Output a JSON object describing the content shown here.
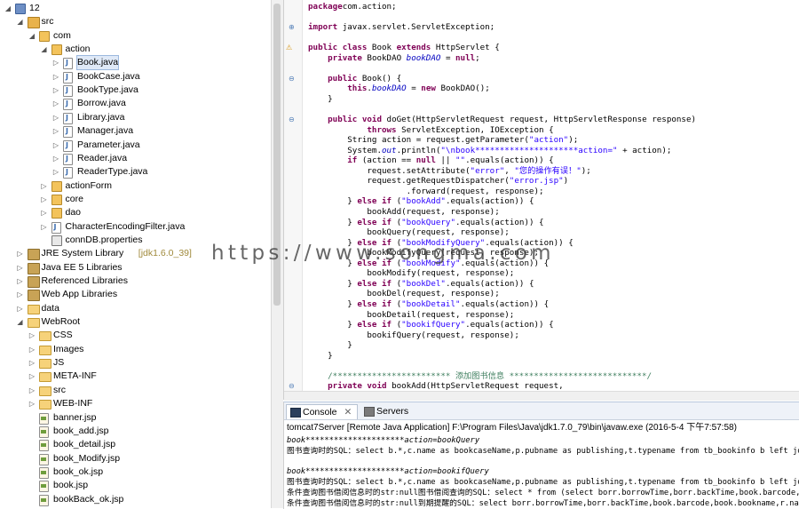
{
  "tree": [
    {
      "label": "12",
      "icon": "project-icon",
      "level": 0,
      "arrow": "down"
    },
    {
      "label": "src",
      "icon": "source-folder-icon",
      "level": 1,
      "arrow": "down"
    },
    {
      "label": "com",
      "icon": "package-icon",
      "level": 2,
      "arrow": "down"
    },
    {
      "label": "action",
      "icon": "package-icon",
      "level": 3,
      "arrow": "down"
    },
    {
      "label": "Book.java",
      "icon": "java-file-icon",
      "level": 4,
      "arrow": "right",
      "selected": true
    },
    {
      "label": "BookCase.java",
      "icon": "java-file-icon",
      "level": 4,
      "arrow": "right"
    },
    {
      "label": "BookType.java",
      "icon": "java-file-icon",
      "level": 4,
      "arrow": "right"
    },
    {
      "label": "Borrow.java",
      "icon": "java-file-icon",
      "level": 4,
      "arrow": "right"
    },
    {
      "label": "Library.java",
      "icon": "java-file-icon",
      "level": 4,
      "arrow": "right"
    },
    {
      "label": "Manager.java",
      "icon": "java-file-icon",
      "level": 4,
      "arrow": "right"
    },
    {
      "label": "Parameter.java",
      "icon": "java-file-icon",
      "level": 4,
      "arrow": "right"
    },
    {
      "label": "Reader.java",
      "icon": "java-file-icon",
      "level": 4,
      "arrow": "right"
    },
    {
      "label": "ReaderType.java",
      "icon": "java-file-icon",
      "level": 4,
      "arrow": "right"
    },
    {
      "label": "actionForm",
      "icon": "package-icon",
      "level": 3,
      "arrow": "right"
    },
    {
      "label": "core",
      "icon": "package-icon",
      "level": 3,
      "arrow": "right"
    },
    {
      "label": "dao",
      "icon": "package-icon",
      "level": 3,
      "arrow": "right"
    },
    {
      "label": "CharacterEncodingFilter.java",
      "icon": "java-file-icon",
      "level": 3,
      "arrow": "right"
    },
    {
      "label": "connDB.properties",
      "icon": "properties-file-icon",
      "level": 3,
      "arrow": ""
    },
    {
      "label": "JRE System Library",
      "deco": "[jdk1.6.0_39]",
      "icon": "library-icon",
      "level": 1,
      "arrow": "right"
    },
    {
      "label": "Java EE 5 Libraries",
      "icon": "library-icon",
      "level": 1,
      "arrow": "right"
    },
    {
      "label": "Referenced Libraries",
      "icon": "library-icon",
      "level": 1,
      "arrow": "right"
    },
    {
      "label": "Web App Libraries",
      "icon": "library-icon",
      "level": 1,
      "arrow": "right"
    },
    {
      "label": "data",
      "icon": "folder-icon",
      "level": 1,
      "arrow": "right"
    },
    {
      "label": "WebRoot",
      "icon": "folder-icon",
      "level": 1,
      "arrow": "down"
    },
    {
      "label": "CSS",
      "icon": "folder-icon",
      "level": 2,
      "arrow": "right"
    },
    {
      "label": "Images",
      "icon": "folder-icon",
      "level": 2,
      "arrow": "right"
    },
    {
      "label": "JS",
      "icon": "folder-icon",
      "level": 2,
      "arrow": "right"
    },
    {
      "label": "META-INF",
      "icon": "folder-icon",
      "level": 2,
      "arrow": "right"
    },
    {
      "label": "src",
      "icon": "folder-icon",
      "level": 2,
      "arrow": "right"
    },
    {
      "label": "WEB-INF",
      "icon": "folder-icon",
      "level": 2,
      "arrow": "right"
    },
    {
      "label": "banner.jsp",
      "icon": "jsp-file-icon",
      "level": 2,
      "arrow": ""
    },
    {
      "label": "book_add.jsp",
      "icon": "jsp-file-icon",
      "level": 2,
      "arrow": ""
    },
    {
      "label": "book_detail.jsp",
      "icon": "jsp-file-icon",
      "level": 2,
      "arrow": ""
    },
    {
      "label": "book_Modify.jsp",
      "icon": "jsp-file-icon",
      "level": 2,
      "arrow": ""
    },
    {
      "label": "book_ok.jsp",
      "icon": "jsp-file-icon",
      "level": 2,
      "arrow": ""
    },
    {
      "label": "book.jsp",
      "icon": "jsp-file-icon",
      "level": 2,
      "arrow": ""
    },
    {
      "label": "bookBack_ok.jsp",
      "icon": "jsp-file-icon",
      "level": 2,
      "arrow": ""
    }
  ],
  "code": [
    [
      [
        "kw",
        "package"
      ],
      [
        "",
        "com.action;"
      ]
    ],
    [],
    [
      [
        "kw",
        "import"
      ],
      [
        "",
        " javax.servlet.ServletException;"
      ]
    ],
    [],
    [
      [
        "kw",
        "public class"
      ],
      [
        "",
        " Book "
      ],
      [
        "kw",
        "extends"
      ],
      [
        "",
        " HttpServlet {"
      ]
    ],
    [
      [
        "",
        "    "
      ],
      [
        "kw",
        "private"
      ],
      [
        "",
        " BookDAO "
      ],
      [
        "fld",
        "bookDAO"
      ],
      [
        "",
        " = "
      ],
      [
        "kw",
        "null"
      ],
      [
        "",
        ";"
      ]
    ],
    [],
    [
      [
        "",
        "    "
      ],
      [
        "kw",
        "public"
      ],
      [
        "",
        " Book() {"
      ]
    ],
    [
      [
        "",
        "        "
      ],
      [
        "kw",
        "this"
      ],
      [
        "",
        "."
      ],
      [
        "fld",
        "bookDAO"
      ],
      [
        "",
        " = "
      ],
      [
        "kw",
        "new"
      ],
      [
        "",
        " BookDAO();"
      ]
    ],
    [
      [
        "",
        "    }"
      ]
    ],
    [],
    [
      [
        "",
        "    "
      ],
      [
        "kw",
        "public void"
      ],
      [
        "",
        " doGet(HttpServletRequest request, HttpServletResponse response)"
      ]
    ],
    [
      [
        "",
        "            "
      ],
      [
        "kw",
        "throws"
      ],
      [
        "",
        " ServletException, IOException {"
      ]
    ],
    [
      [
        "",
        "        String action = request.getParameter("
      ],
      [
        "str",
        "\"action\""
      ],
      [
        "",
        ");"
      ]
    ],
    [
      [
        "",
        "        System."
      ],
      [
        "fld",
        "out"
      ],
      [
        "",
        ".println("
      ],
      [
        "str",
        "\"\\nbook*********************action=\""
      ],
      [
        "",
        " + action);"
      ]
    ],
    [
      [
        "",
        "        "
      ],
      [
        "kw",
        "if"
      ],
      [
        "",
        " (action == "
      ],
      [
        "kw",
        "null"
      ],
      [
        "",
        " || "
      ],
      [
        "str",
        "\"\""
      ],
      [
        "",
        ".equals(action)) {"
      ]
    ],
    [
      [
        "",
        "            request.setAttribute("
      ],
      [
        "str",
        "\"error\""
      ],
      [
        "",
        ", "
      ],
      [
        "str",
        "\"您的操作有误！\""
      ],
      [
        "",
        ");"
      ]
    ],
    [
      [
        "",
        "            request.getRequestDispatcher("
      ],
      [
        "str",
        "\"error.jsp\""
      ],
      [
        "",
        ")"
      ]
    ],
    [
      [
        "",
        "                    .forward(request, response);"
      ]
    ],
    [
      [
        "",
        "        } "
      ],
      [
        "kw",
        "else if"
      ],
      [
        "",
        " ("
      ],
      [
        "str",
        "\"bookAdd\""
      ],
      [
        "",
        ".equals(action)) {"
      ]
    ],
    [
      [
        "",
        "            bookAdd(request, response);"
      ]
    ],
    [
      [
        "",
        "        } "
      ],
      [
        "kw",
        "else if"
      ],
      [
        "",
        " ("
      ],
      [
        "str",
        "\"bookQuery\""
      ],
      [
        "",
        ".equals(action)) {"
      ]
    ],
    [
      [
        "",
        "            bookQuery(request, response);"
      ]
    ],
    [
      [
        "",
        "        } "
      ],
      [
        "kw",
        "else if"
      ],
      [
        "",
        " ("
      ],
      [
        "str",
        "\"bookModifyQuery\""
      ],
      [
        "",
        ".equals(action)) {"
      ]
    ],
    [
      [
        "",
        "            bookModifyQuery(request, response);"
      ]
    ],
    [
      [
        "",
        "        } "
      ],
      [
        "kw",
        "else if"
      ],
      [
        "",
        " ("
      ],
      [
        "str",
        "\"bookModify\""
      ],
      [
        "",
        ".equals(action)) {"
      ]
    ],
    [
      [
        "",
        "            bookModify(request, response);"
      ]
    ],
    [
      [
        "",
        "        } "
      ],
      [
        "kw",
        "else if"
      ],
      [
        "",
        " ("
      ],
      [
        "str",
        "\"bookDel\""
      ],
      [
        "",
        ".equals(action)) {"
      ]
    ],
    [
      [
        "",
        "            bookDel(request, response);"
      ]
    ],
    [
      [
        "",
        "        } "
      ],
      [
        "kw",
        "else if"
      ],
      [
        "",
        " ("
      ],
      [
        "str",
        "\"bookDetail\""
      ],
      [
        "",
        ".equals(action)) {"
      ]
    ],
    [
      [
        "",
        "            bookDetail(request, response);"
      ]
    ],
    [
      [
        "",
        "        } "
      ],
      [
        "kw",
        "else if"
      ],
      [
        "",
        " ("
      ],
      [
        "str",
        "\"bookifQuery\""
      ],
      [
        "",
        ".equals(action)) {"
      ]
    ],
    [
      [
        "",
        "            bookifQuery(request, response);"
      ]
    ],
    [
      [
        "",
        "        }"
      ]
    ],
    [
      [
        "",
        "    }"
      ]
    ],
    [],
    [
      [
        "",
        "    "
      ],
      [
        "cmt",
        "/************************ 添加图书信息 ****************************/"
      ]
    ],
    [
      [
        "",
        "    "
      ],
      [
        "kw",
        "private void"
      ],
      [
        "",
        " bookAdd(HttpServletRequest request,"
      ]
    ]
  ],
  "console": {
    "tab_console": "Console",
    "tab_servers": "Servers",
    "title": "tomcat7Server [Remote Java Application] F:\\Program Files\\Java\\jdk1.7.0_79\\bin\\javaw.exe (2016-5-4 下午7:57:58)",
    "lines": [
      [
        "book*********************action=bookQuery",
        true
      ],
      [
        "图书查询时的SQL：select b.*,c.name as bookcaseName,p.pubname as publishing,t.typename from tb_bookinfo b left jo",
        false
      ],
      [
        "",
        false
      ],
      [
        "book*********************action=bookifQuery",
        true
      ],
      [
        "图书查询时的SQL：select b.*,c.name as bookcaseName,p.pubname as publishing,t.typename from tb_bookinfo b left jo",
        false
      ],
      [
        "条件查询图书借阅信息时的str:null图书借阅查询的SQL：select * from (select borr.borrowTime,borr.backTime,book.barcode,book.boo",
        false
      ],
      [
        "条件查询图书借阅信息时的str:null到期提醒的SQL：select borr.borrowTime,borr.backTime,book.barcode,book.bookname,r.name re",
        false
      ]
    ]
  },
  "watermark": "https://www.songma.com"
}
